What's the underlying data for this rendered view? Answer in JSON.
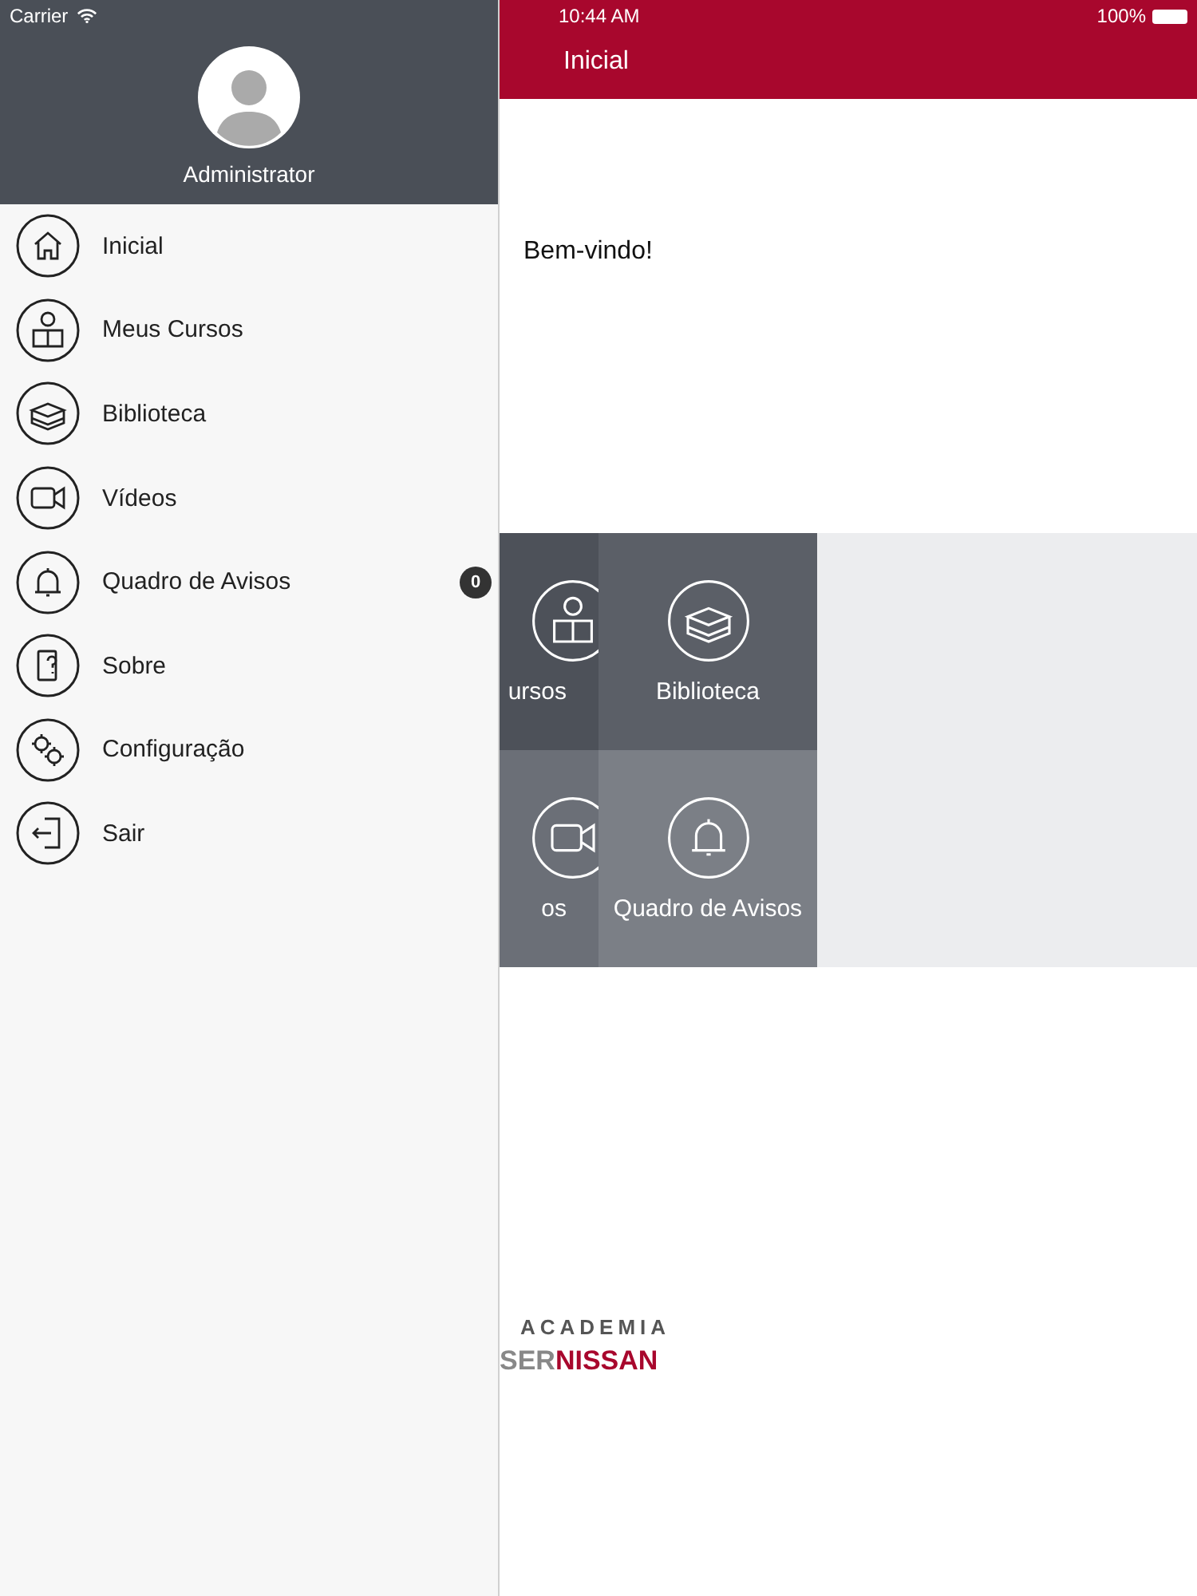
{
  "status_bar": {
    "carrier": "Carrier",
    "time": "10:44 AM",
    "battery": "100%"
  },
  "drawer": {
    "user_name": "Administrator",
    "items": [
      {
        "label": "Inicial"
      },
      {
        "label": "Meus Cursos"
      },
      {
        "label": "Biblioteca"
      },
      {
        "label": "Vídeos"
      },
      {
        "label": "Quadro de Avisos",
        "badge": "0"
      },
      {
        "label": "Sobre"
      },
      {
        "label": "Configuração"
      },
      {
        "label": "Sair"
      }
    ]
  },
  "header": {
    "title": "Inicial"
  },
  "welcome": "Bem-vindo!",
  "tiles": [
    {
      "label": "ursos"
    },
    {
      "label": "Biblioteca"
    },
    {
      "label": "os"
    },
    {
      "label": "Quadro de Avisos"
    }
  ],
  "logo": {
    "line_1": "ACADEMIA",
    "line_2": "SER**NISSAN**"
  }
}
